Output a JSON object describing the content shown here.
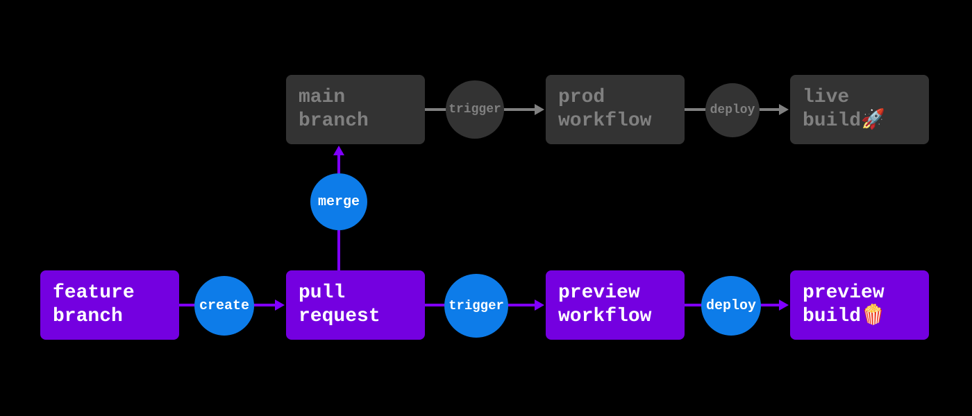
{
  "nodes": {
    "feature_branch": "feature\nbranch",
    "pull_request": "pull\nrequest",
    "preview_workflow": "preview\nworkflow",
    "preview_build": "preview\nbuild🍿",
    "main_branch": "main\nbranch",
    "prod_workflow": "prod\nworkflow",
    "live_build": "live\nbuild🚀"
  },
  "edges": {
    "create": "create",
    "trigger_preview": "trigger",
    "deploy_preview": "deploy",
    "merge": "merge",
    "trigger_prod": "trigger",
    "deploy_prod": "deploy"
  }
}
